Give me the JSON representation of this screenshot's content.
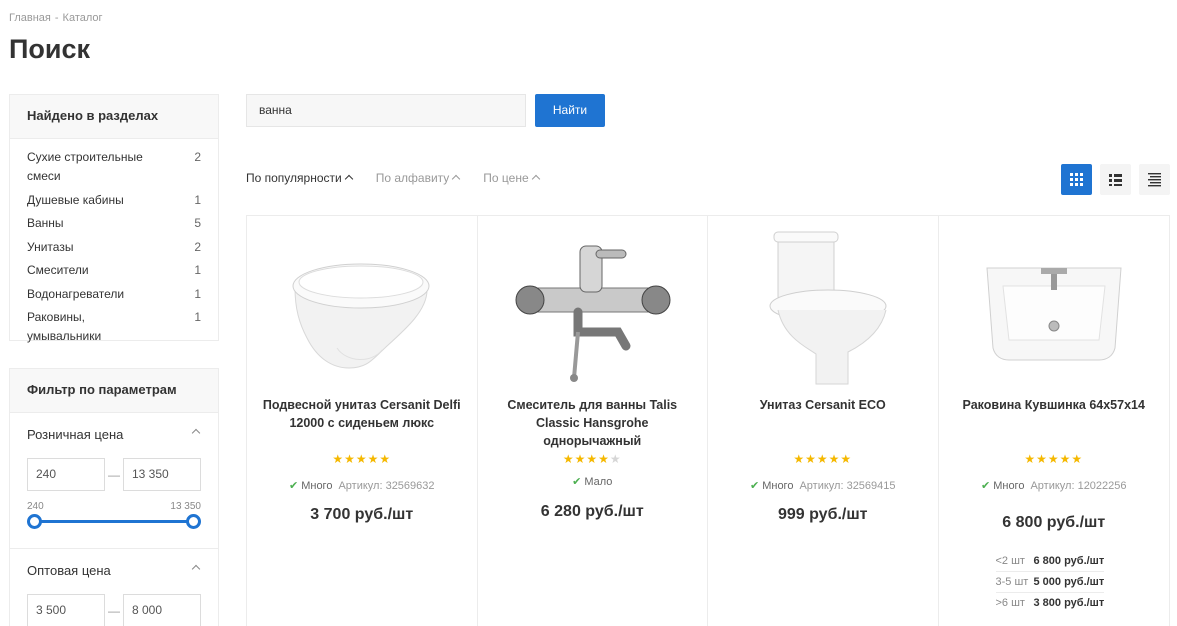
{
  "breadcrumb": {
    "home": "Главная",
    "sep": "-",
    "catalog": "Каталог"
  },
  "page_title": "Поиск",
  "sections": {
    "title": "Найдено в разделах",
    "items": [
      {
        "label": "Сухие строительные смеси",
        "count": "2"
      },
      {
        "label": "Душевые кабины",
        "count": "1"
      },
      {
        "label": "Ванны",
        "count": "5"
      },
      {
        "label": "Унитазы",
        "count": "2"
      },
      {
        "label": "Смесители",
        "count": "1"
      },
      {
        "label": "Водонагреватели",
        "count": "1"
      },
      {
        "label": "Раковины, умывальники",
        "count": "1"
      }
    ]
  },
  "filter": {
    "title": "Фильтр по параметрам",
    "retail": {
      "label": "Розничная цена",
      "from": "240",
      "to": "13 350",
      "min": "240",
      "max": "13 350"
    },
    "wholesale": {
      "label": "Оптовая цена",
      "from": "3 500",
      "to": "8 000"
    },
    "dash": "—"
  },
  "search": {
    "value": "ванна",
    "button": "Найти"
  },
  "sort": {
    "popularity": "По популярности",
    "alphabet": "По алфавиту",
    "price": "По цене"
  },
  "view": {
    "active": "grid",
    "modes": [
      "grid-icon",
      "list-icon",
      "table-icon"
    ],
    "accent": "#1f74d2"
  },
  "products": [
    {
      "title": "Подвесной унитаз Cersanit Delfi 12000 с сиденьем люкс",
      "rating": 5,
      "stock": "Много",
      "article": "Артикул: 32569632",
      "price": "3 700 руб./шт",
      "image": "wall-hung-toilet"
    },
    {
      "title": "Смеситель для ванны Talis Classic Hansgrohe однорычажный",
      "rating": 4,
      "stock": "Мало",
      "article": "",
      "price": "6 280 руб./шт",
      "image": "bath-mixer"
    },
    {
      "title": "Унитаз Cersanit ECO",
      "rating": 5,
      "stock": "Много",
      "article": "Артикул: 32569415",
      "price": "999 руб./шт",
      "image": "floor-toilet"
    },
    {
      "title": "Раковина Кувшинка 64x57x14",
      "rating": 5,
      "stock": "Много",
      "article": "Артикул: 12022256",
      "price": "6 800 руб./шт",
      "image": "washbasin",
      "tiers": [
        {
          "qty": "<2 шт",
          "price": "6 800 руб./шт"
        },
        {
          "qty": "3-5 шт",
          "price": "5 000 руб./шт"
        },
        {
          "qty": ">6 шт",
          "price": "3 800 руб./шт"
        }
      ]
    }
  ]
}
